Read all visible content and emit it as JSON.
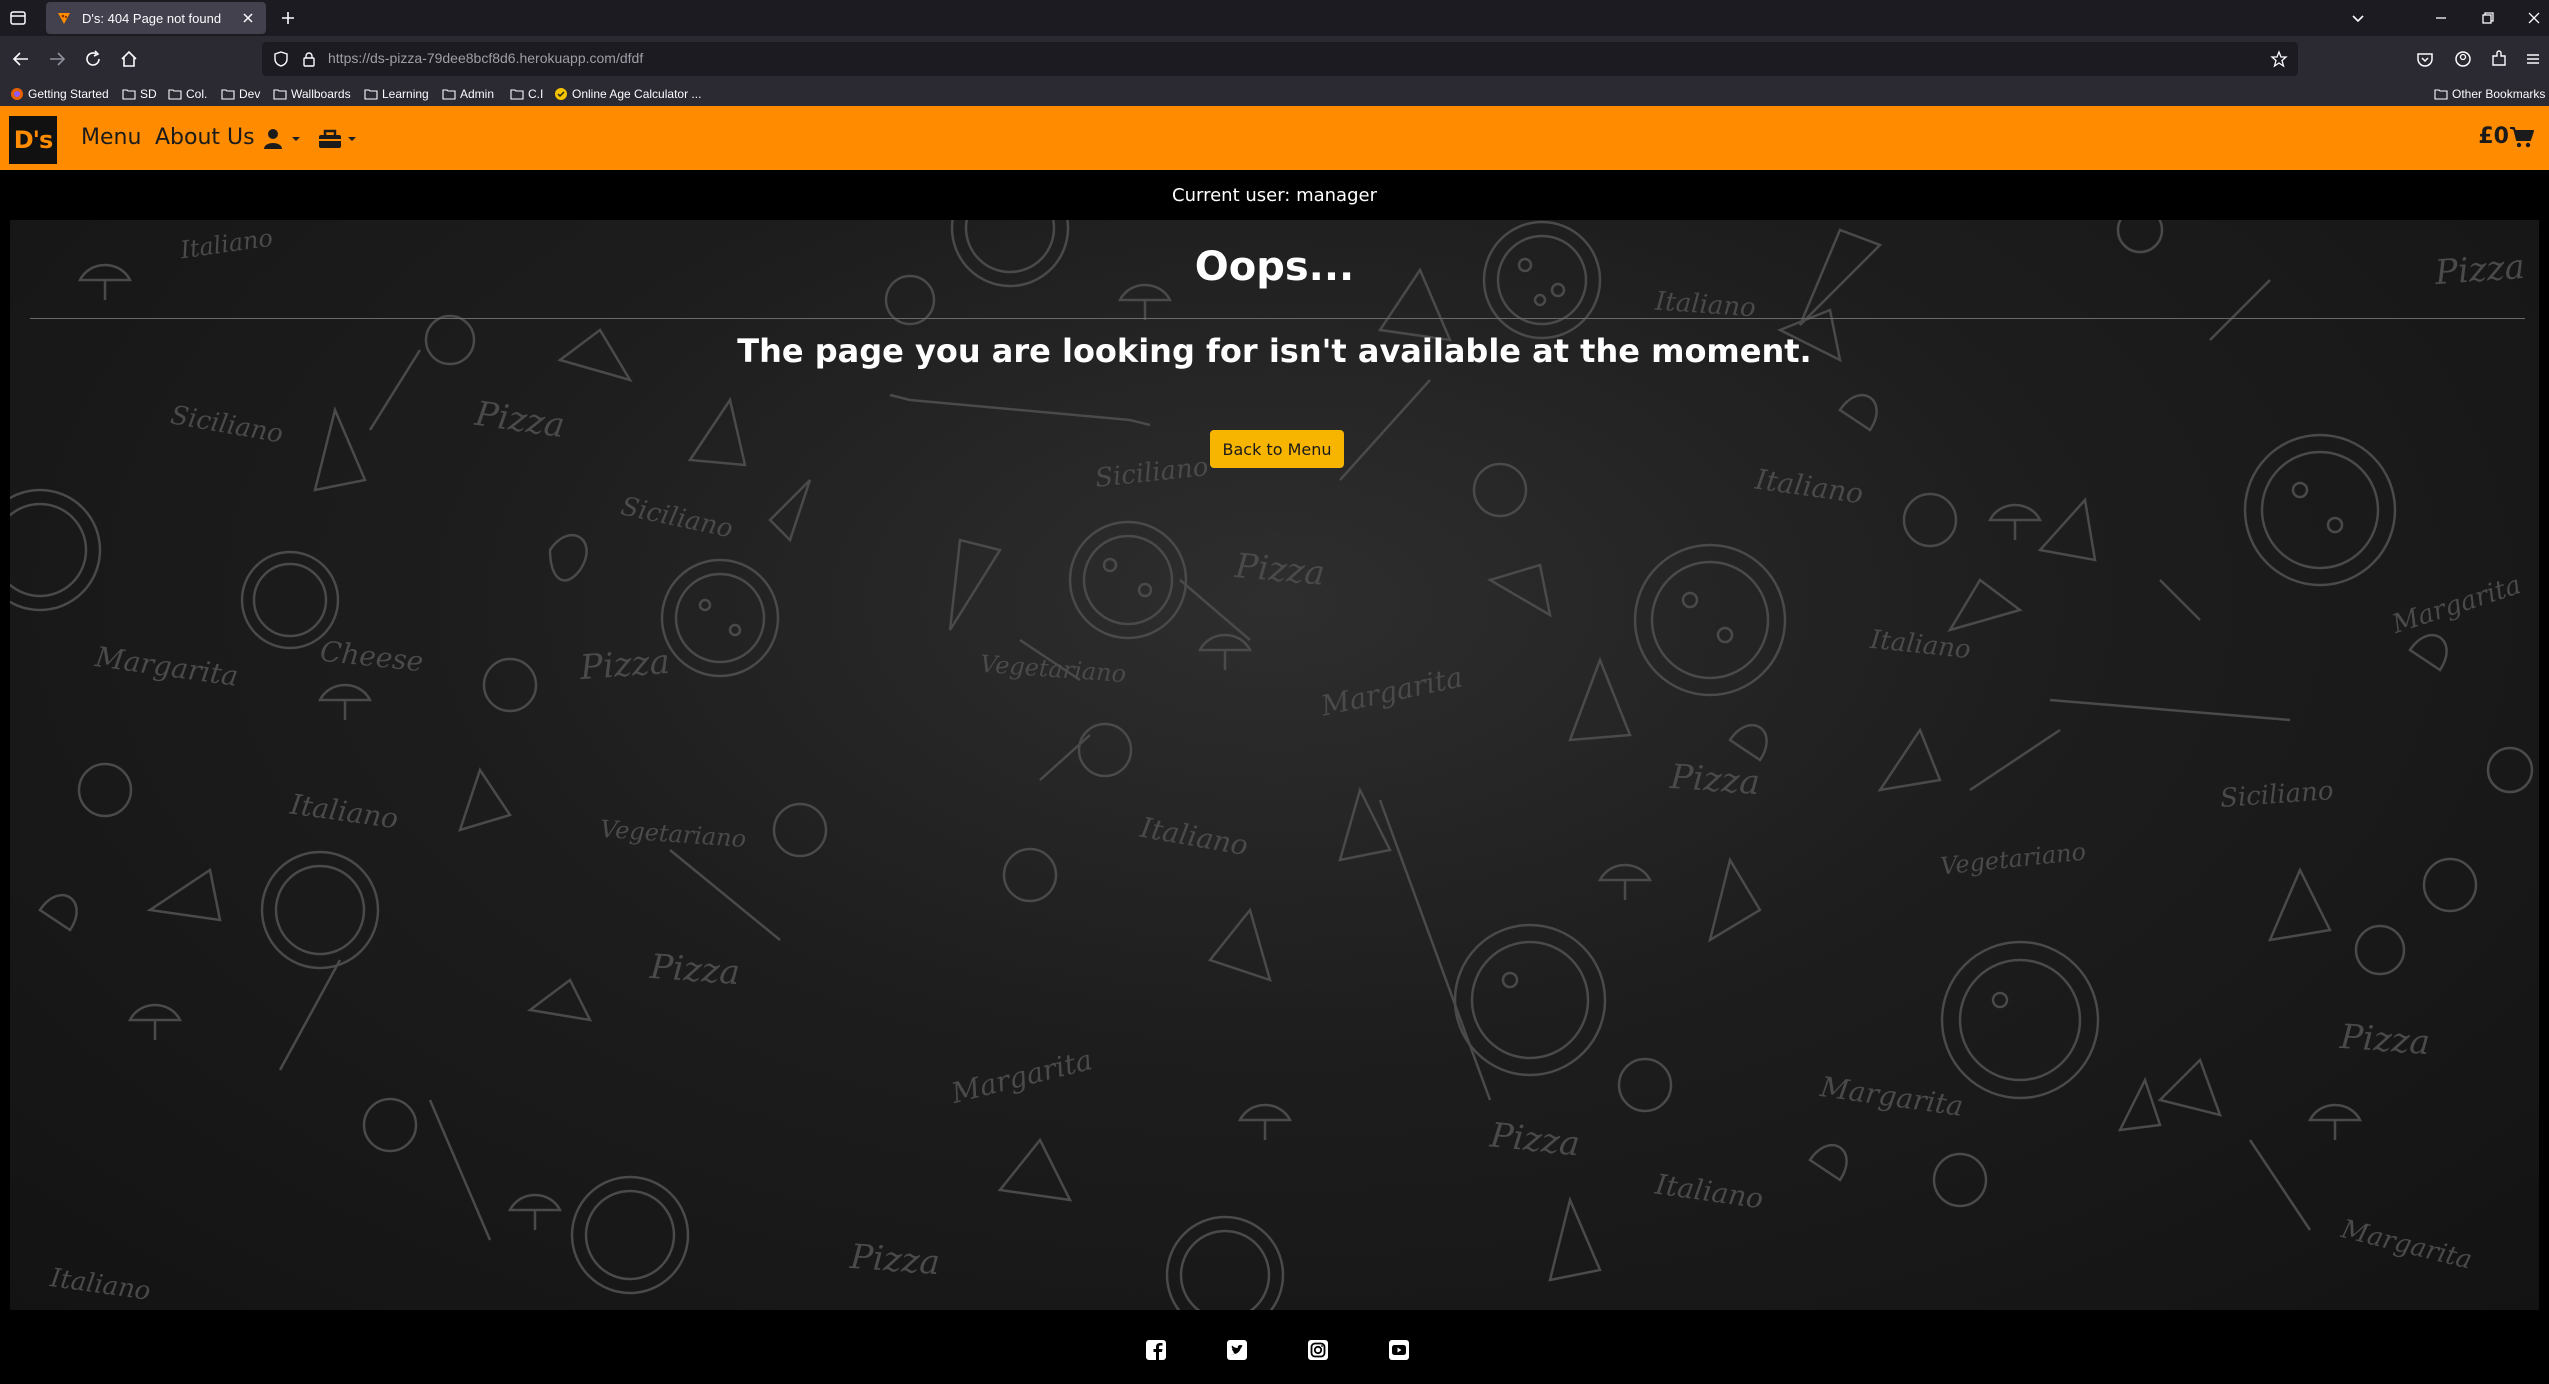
{
  "browser": {
    "tab_title": "D's: 404 Page not found",
    "url_host": "https://ds-pizza-79dee8bcf8d6.herokuapp.com",
    "url_path": "/dfdf",
    "bookmarks": [
      "Getting Started",
      "SD",
      "Col.",
      "Dev",
      "Wallboards",
      "Learning",
      "Admin",
      "C.I",
      "Online Age Calculator ..."
    ],
    "other_bookmarks": "Other Bookmarks"
  },
  "site": {
    "logo": "D's",
    "nav": {
      "menu": "Menu",
      "about": "About Us"
    },
    "cart_total": "£0",
    "brand_color": "#ff8c00",
    "current_user": "Current user: manager"
  },
  "error": {
    "heading": "Oops...",
    "message": "The page you are looking for isn't available at the moment.",
    "button": "Back to Menu"
  },
  "background_words": [
    "Italiano",
    "Pizza",
    "Siciliano",
    "Margarita",
    "Cheese",
    "Vegetariano"
  ],
  "footer": {
    "icons": [
      "facebook-icon",
      "twitter-icon",
      "instagram-icon",
      "youtube-icon"
    ]
  }
}
